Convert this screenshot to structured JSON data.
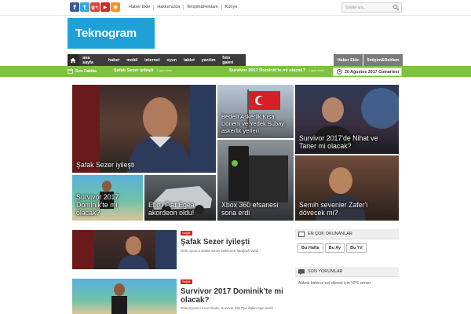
{
  "social": [
    {
      "name": "facebook",
      "glyph": "f",
      "color": "#3b5998"
    },
    {
      "name": "twitter",
      "glyph": "t",
      "color": "#2fa8e0"
    },
    {
      "name": "googleplus",
      "glyph": "g+",
      "color": "#d34836"
    },
    {
      "name": "youtube",
      "glyph": "▶",
      "color": "#d12a26"
    },
    {
      "name": "rss",
      "glyph": "◉",
      "color": "#f39224"
    }
  ],
  "topnav": {
    "items": [
      "Haber Ekle",
      "Hakkımızda",
      "İletişim&Reklam",
      "Künye"
    ]
  },
  "search": {
    "placeholder": "Sitede ara..."
  },
  "logo": {
    "text": "Teknogram"
  },
  "mainnav": {
    "items": [
      "ana sayfa",
      "haber",
      "mobil",
      "internet",
      "oyun",
      "tablet",
      "yazılım",
      "foto galeri"
    ]
  },
  "navright": {
    "add": "Haber Ekle",
    "contact": "İletişim&Reklam"
  },
  "ticker": {
    "label": "Son Dakika",
    "items": [
      {
        "title": "Şafak Sezer iyileşti",
        "meta": "1 gün önce"
      },
      {
        "title": "Survivor 2017 Dominik'te mi olacak?",
        "meta": "1 gün önce"
      }
    ],
    "date": "26 Ağustos 2017 Cumartesi"
  },
  "tiles": {
    "safak": "Şafak Sezer iyileşti",
    "bedelli": "Bedelli Askerlik Kısa Dönem ve Yedek Subay askerlik yerleri",
    "acun": "Survivor 2017'de Nihat ve Taner mi olacak?",
    "dominik": "Survivor 2017 Dominik'te mi olacak?",
    "ebru": "Ebru Fiat Egea akordeon oldu!",
    "xbox": "Xbox 360 efsanesi sona erdi",
    "semih": "Semih sevenler Zafer'i dövecek mi?"
  },
  "posts": [
    {
      "badge": "Sağlık",
      "title": "Şafak Sezer iyileşti",
      "desc": "Ünlü oyuncu Şafak Sezer beklenen fotoğrafı verdi"
    },
    {
      "badge": "Sağlık",
      "title": "Survivor 2017 Dominik'te mi olacak?",
      "desc": "Televizyoncu Acun Ilıcalı, Survivor 2017'ye ilişkin tüyo verdi"
    }
  ],
  "widgets": {
    "popular": {
      "title": "EN ÇOK OKUNANLAR",
      "tabs": [
        "Bu Hafta",
        "Bu Ay",
        "Bu Yıl"
      ]
    },
    "comments": {
      "title": "SON YORUMLAR",
      "entry": "Airbnb birlerce evi silecek için VPS server"
    }
  }
}
